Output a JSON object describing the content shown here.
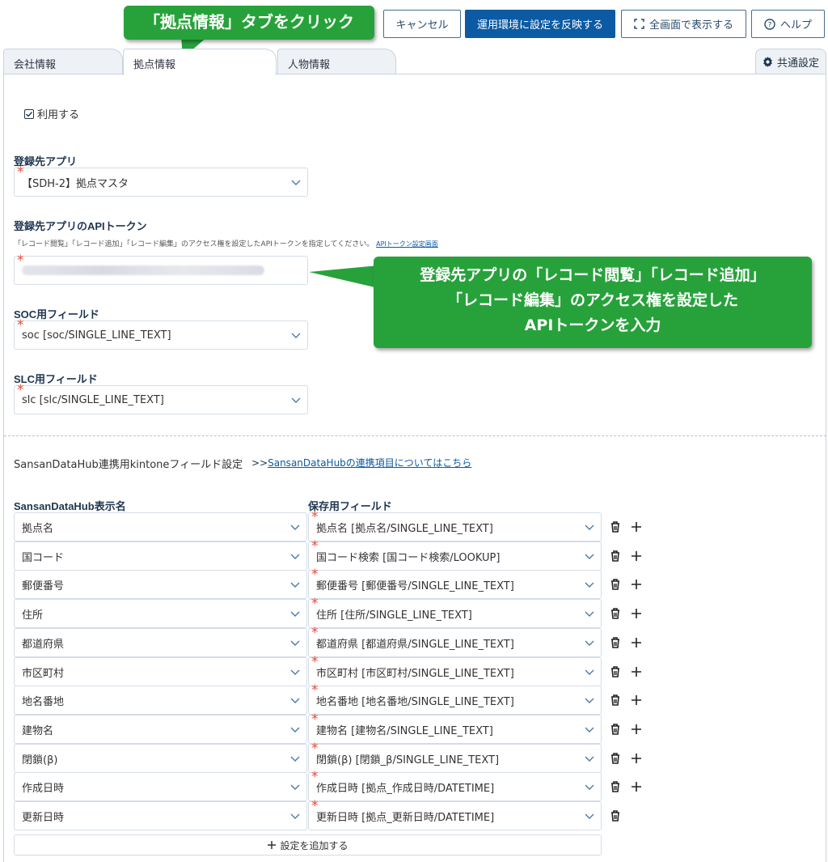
{
  "toolbar": {
    "cancel": "キャンセル",
    "apply": "運用環境に設定を反映する",
    "fullscreen": "全画面で表示する",
    "help": "ヘルプ"
  },
  "tabs": {
    "company": "会社情報",
    "location": "拠点情報",
    "person": "人物情報",
    "common": "共通設定"
  },
  "callouts": {
    "tab_hint": "「拠点情報」タブをクリック",
    "token_hint": [
      "登録先アプリの「レコード閲覧」「レコード追加」",
      "「レコード編集」のアクセス権を設定した",
      "APIトークンを入力"
    ]
  },
  "form": {
    "use_label": "利用する",
    "use_checked": true,
    "target_app_label": "登録先アプリ",
    "target_app_value": "【SDH-2】拠点マスタ",
    "api_token_label": "登録先アプリのAPIトークン",
    "api_token_desc": "「レコード閲覧」「レコード追加」「レコード編集」のアクセス権を設定したAPIトークンを指定してください。",
    "api_token_link": "APIトークン設定画面",
    "soc_label": "SOC用フィールド",
    "soc_value": "soc [soc/SINGLE_LINE_TEXT]",
    "slc_label": "SLC用フィールド",
    "slc_value": "slc [slc/SINGLE_LINE_TEXT]"
  },
  "mapping": {
    "section_title": "SansanDataHub連携用kintoneフィールド設定",
    "section_link_prefix": ">>",
    "section_link": "SansanDataHubの連携項目についてはこちら",
    "col_left": "SansanDataHub表示名",
    "col_right": "保存用フィールド",
    "rows": [
      {
        "label": "拠点名",
        "field": "拠点名 [拠点名/SINGLE_LINE_TEXT]",
        "add": true
      },
      {
        "label": "国コード",
        "field": "国コード検索 [国コード検索/LOOKUP]",
        "add": true
      },
      {
        "label": "郵便番号",
        "field": "郵便番号 [郵便番号/SINGLE_LINE_TEXT]",
        "add": true
      },
      {
        "label": "住所",
        "field": "住所 [住所/SINGLE_LINE_TEXT]",
        "add": true
      },
      {
        "label": "都道府県",
        "field": "都道府県 [都道府県/SINGLE_LINE_TEXT]",
        "add": true
      },
      {
        "label": "市区町村",
        "field": "市区町村 [市区町村/SINGLE_LINE_TEXT]",
        "add": true
      },
      {
        "label": "地名番地",
        "field": "地名番地 [地名番地/SINGLE_LINE_TEXT]",
        "add": true
      },
      {
        "label": "建物名",
        "field": "建物名 [建物名/SINGLE_LINE_TEXT]",
        "add": true
      },
      {
        "label": "閉鎖(β)",
        "field": "閉鎖(β) [閉鎖_β/SINGLE_LINE_TEXT]",
        "add": true
      },
      {
        "label": "作成日時",
        "field": "作成日時 [拠点_作成日時/DATETIME]",
        "add": true
      },
      {
        "label": "更新日時",
        "field": "更新日時 [拠点_更新日時/DATETIME]",
        "add": false
      }
    ],
    "add_setting": "設定を追加する"
  },
  "colors": {
    "primary": "#0b5aa3",
    "callout_green": "#27a23b",
    "required": "#e74c3c",
    "label": "#1f3550"
  }
}
